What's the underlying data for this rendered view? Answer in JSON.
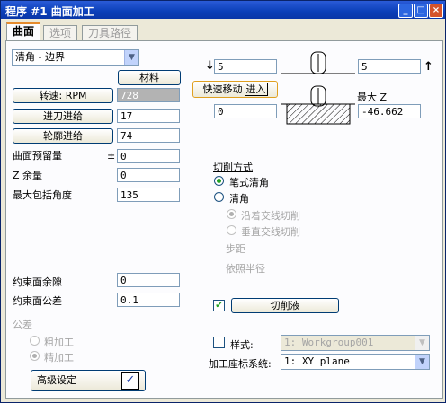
{
  "window": {
    "title": "程序 #1 曲面加工"
  },
  "tabs": [
    "曲面",
    "选项",
    "刀具路径"
  ],
  "operation": {
    "selected": "清角 - 边界"
  },
  "buttons": {
    "material": "材料",
    "spindle": "转速: RPM",
    "feed": "进刀进给",
    "contour": "轮廓进给",
    "rapid": "快速移动",
    "rapid_sub": "进入",
    "coolant": "切削液",
    "advanced": "高级设定"
  },
  "values": {
    "spindle": "728",
    "feed": "17",
    "contour": "74",
    "stock": "0",
    "z_allowance": "0",
    "max_angle": "135",
    "top_left": "5",
    "top_right": "5",
    "bottom_left": "0",
    "max_z": "-46.662",
    "constraint_clearance": "0",
    "constraint_tolerance": "0.1"
  },
  "labels": {
    "stock": "曲面预留量",
    "plus_minus": "±",
    "z_allowance": "Z 余量",
    "max_angle": "最大包括角度",
    "max_z": "最大 Z",
    "constraint_clearance": "约束面余隙",
    "constraint_tolerance": "约束面公差",
    "tolerance_group": "公差",
    "rough": "粗加工",
    "finish": "精加工",
    "cut_method": "切削方式",
    "pen_clean": "笔式清角",
    "clean": "清角",
    "along_cross": "沿着交线切削",
    "perp_cross": "垂直交线切削",
    "step": "步距",
    "radius": "依照半径",
    "style": "样式:",
    "coord_system": "加工座标系统:",
    "arrow_down": "↓",
    "arrow_up": "↑"
  },
  "selects": {
    "style": "1: Workgroup001",
    "coord_system": "1: XY plane"
  },
  "title_buttons": [
    "_",
    "□",
    "×"
  ]
}
